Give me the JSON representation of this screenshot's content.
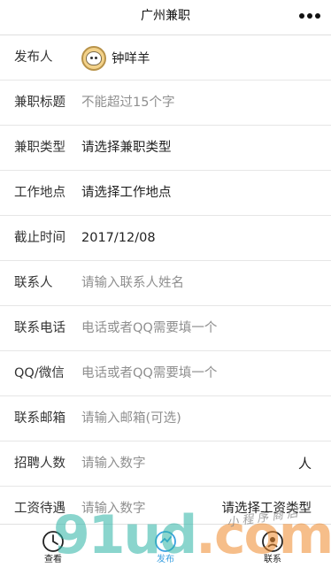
{
  "nav": {
    "title": "广州兼职"
  },
  "form": {
    "publisher": {
      "label": "发布人",
      "name": "钟咩羊"
    },
    "title": {
      "label": "兼职标题",
      "placeholder": "不能超过15个字"
    },
    "type": {
      "label": "兼职类型",
      "value": "请选择兼职类型"
    },
    "location": {
      "label": "工作地点",
      "value": "请选择工作地点"
    },
    "deadline": {
      "label": "截止时间",
      "value": "2017/12/08"
    },
    "contact": {
      "label": "联系人",
      "placeholder": "请输入联系人姓名"
    },
    "phone": {
      "label": "联系电话",
      "placeholder": "电话或者QQ需要填一个"
    },
    "qq": {
      "label": "QQ/微信",
      "placeholder": "电话或者QQ需要填一个"
    },
    "email": {
      "label": "联系邮箱",
      "placeholder": "请输入邮箱(可选)"
    },
    "headcount": {
      "label": "招聘人数",
      "placeholder": "请输入数字",
      "unit": "人"
    },
    "salary": {
      "label": "工资待遇",
      "placeholder": "请输入数字",
      "type_picker": "请选择工资类型"
    }
  },
  "tabbar": {
    "tabs": [
      {
        "label": "查看",
        "icon": "clock-icon"
      },
      {
        "label": "发布",
        "icon": "publish-icon"
      },
      {
        "label": "联系",
        "icon": "contact-icon"
      }
    ]
  },
  "watermark": {
    "big": "91ud.com",
    "script": "小程序商店"
  },
  "colors": {
    "accent": "#3aa0e0",
    "placeholder": "#8f8f8f",
    "divider": "#e6e6e6"
  }
}
